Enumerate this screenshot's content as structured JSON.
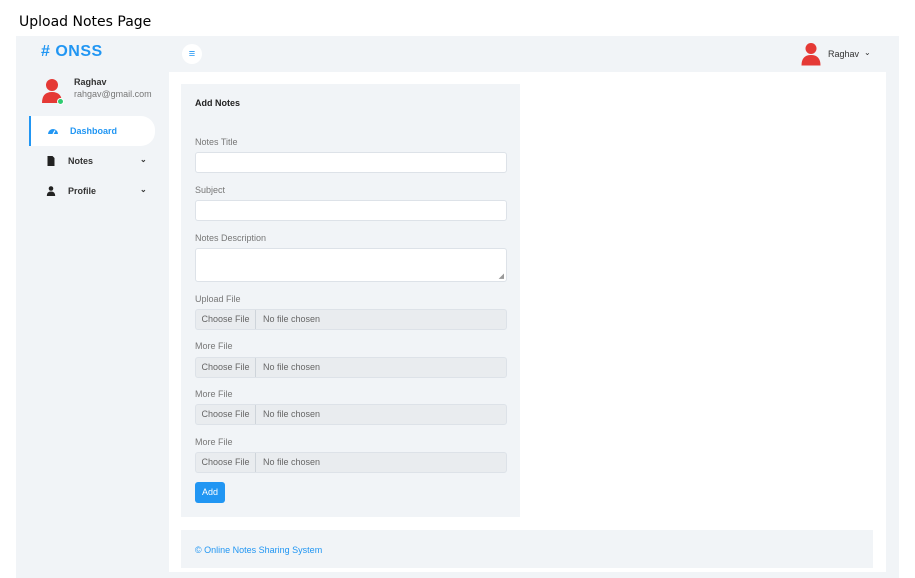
{
  "caption": "Upload Notes Page",
  "brand": "# ONSS",
  "user": {
    "name": "Raghav",
    "email": "rahgav@gmail.com"
  },
  "nav": [
    {
      "label": "Dashboard",
      "icon": "dashboard-icon"
    },
    {
      "label": "Notes",
      "icon": "file-icon"
    },
    {
      "label": "Profile",
      "icon": "user-icon"
    }
  ],
  "topbar": {
    "menu_icon": "≡",
    "user_name": "Raghav"
  },
  "form": {
    "title": "Add Notes",
    "notes_title_label": "Notes Title",
    "subject_label": "Subject",
    "description_label": "Notes Description",
    "upload_label": "Upload File",
    "more_label_1": "More File",
    "more_label_2": "More File",
    "more_label_3": "More File",
    "choose_label": "Choose File",
    "no_file": "No file chosen",
    "add_label": "Add"
  },
  "footer": "© Online Notes Sharing System",
  "colors": {
    "accent": "#2196f3",
    "avatar": "#e53935",
    "online": "#2ecc71",
    "panel": "#f1f4f7"
  }
}
